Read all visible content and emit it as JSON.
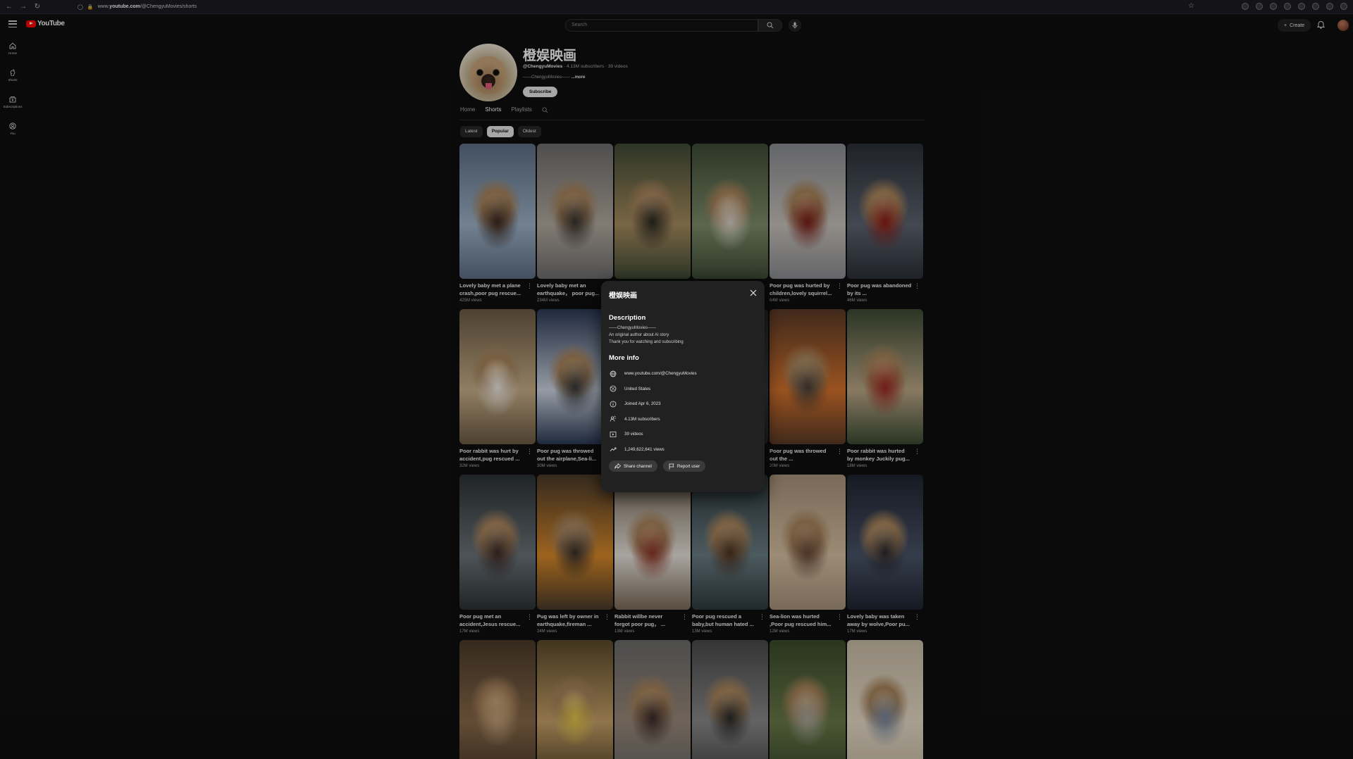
{
  "browser": {
    "url_prefix": "www.",
    "url_domain": "youtube.com",
    "url_path": "/@ChengyuMovies/shorts"
  },
  "header": {
    "logo_text": "YouTube",
    "search_placeholder": "Search",
    "create_label": "Create"
  },
  "sidebar": {
    "items": [
      {
        "label": "Home",
        "icon": "home-icon"
      },
      {
        "label": "Shorts",
        "icon": "shorts-icon"
      },
      {
        "label": "Subscriptions",
        "icon": "subscriptions-icon"
      },
      {
        "label": "You",
        "icon": "you-icon"
      }
    ]
  },
  "channel": {
    "name": "橙娱映画",
    "handle": "@ChengyuMovies",
    "subscribers": "4.13M subscribers",
    "videos": "39 videos",
    "desc_short": "——ChengyuMovies——",
    "more": "...more",
    "subscribe_label": "Subscribe"
  },
  "tabs": [
    {
      "label": "Home",
      "active": false
    },
    {
      "label": "Shorts",
      "active": true
    },
    {
      "label": "Playlists",
      "active": false
    }
  ],
  "chips": [
    {
      "label": "Latest",
      "active": false
    },
    {
      "label": "Popular",
      "active": true
    },
    {
      "label": "Oldest",
      "active": false
    }
  ],
  "shorts": [
    {
      "title": "Lovely baby met a plane crash,poor pug rescue...",
      "views": "425M views"
    },
    {
      "title": "Lovely baby met an earthquake，  poor pug...",
      "views": "234M views"
    },
    {
      "title": "",
      "views": ""
    },
    {
      "title": "",
      "views": ""
    },
    {
      "title": "Poor pug was hurted by children,lovely squirrel...",
      "views": "64M views"
    },
    {
      "title": "Poor pug was abandoned by its ...",
      "views": "46M views"
    },
    {
      "title": "Poor rabbit was hurt by accident,pug rescued ...",
      "views": "32M views"
    },
    {
      "title": "Poor pug was throwed out the airplane,Sea-li...",
      "views": "30M views"
    },
    {
      "title": "",
      "views": ""
    },
    {
      "title": "",
      "views": ""
    },
    {
      "title": "Poor pug was throwed out the ...",
      "views": "20M views"
    },
    {
      "title": "Poor rabbit was hurted by monkey Juckily pug...",
      "views": "18M views"
    },
    {
      "title": "Poor pug met an accident,Jesus rescue...",
      "views": "17M views"
    },
    {
      "title": "Pug was left by owner in earthquake,fireman ...",
      "views": "24M views"
    },
    {
      "title": "Rabbit willbe never forgot poor pug，  ...",
      "views": "13M views"
    },
    {
      "title": "Poor pug rescued a baby,but human hated ...",
      "views": "13M views"
    },
    {
      "title": "Sea-lion was hurted ,Poor pug rescued him...",
      "views": "12M views"
    },
    {
      "title": "Lovely baby was taken away by wolve,Poor pu...",
      "views": "17M views"
    },
    {
      "title": "",
      "views": ""
    },
    {
      "title": "",
      "views": ""
    },
    {
      "title": "",
      "views": ""
    },
    {
      "title": "",
      "views": ""
    },
    {
      "title": "",
      "views": ""
    },
    {
      "title": "",
      "views": ""
    }
  ],
  "dialog": {
    "title": "橙娱映画",
    "description_heading": "Description",
    "description_lines": [
      "——ChengyuMovies——",
      "An original author about AI  story",
      "Thank you for watching and subscribing"
    ],
    "more_info_heading": "More info",
    "info": [
      {
        "icon": "globe-icon",
        "text": "www.youtube.com/@ChengyuMovies"
      },
      {
        "icon": "location-icon",
        "text": "United States"
      },
      {
        "icon": "info-icon",
        "text": "Joined Apr 6, 2023"
      },
      {
        "icon": "subscribers-icon",
        "text": "4.13M subscribers"
      },
      {
        "icon": "video-icon",
        "text": "39 videos"
      },
      {
        "icon": "trending-icon",
        "text": "1,249,622,641 views"
      }
    ],
    "share_label": "Share channel",
    "report_label": "Report user"
  }
}
